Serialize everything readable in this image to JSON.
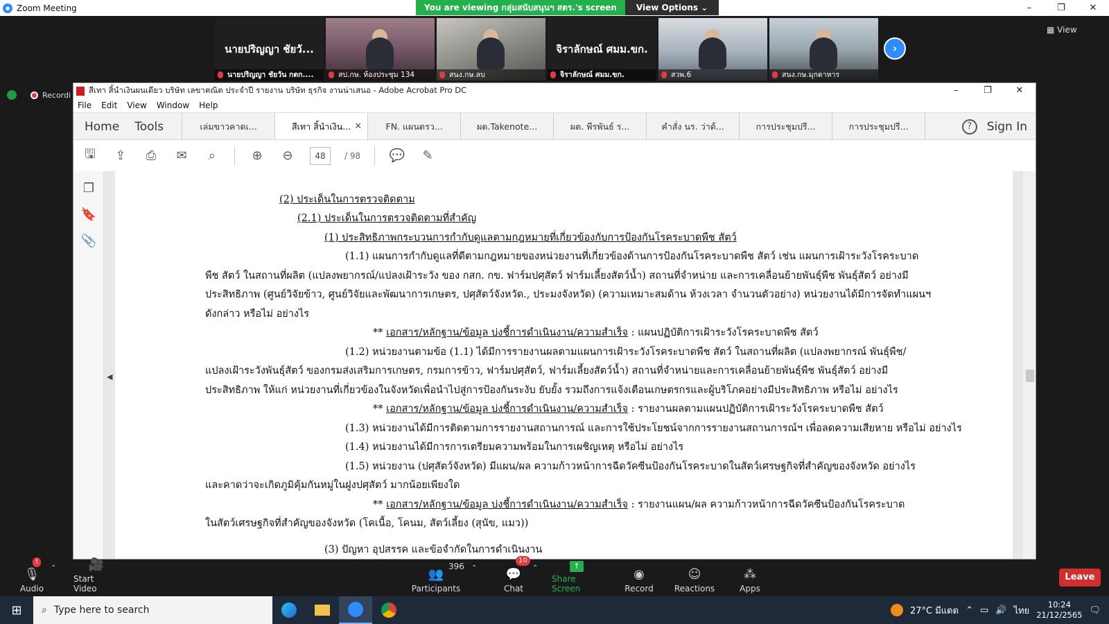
{
  "zoom": {
    "window_title": "Zoom Meeting",
    "share_banner": "You are viewing กลุ่มสนับสนุนฯ สตร.'s screen",
    "view_options": "View Options ⌄",
    "view_button": "View",
    "recording_label": "Recordi",
    "tiles": [
      {
        "kind": "name",
        "name": "นายปริญญา ชัยวั...",
        "caption": "นายปริญญา ชัยวัน กตก...."
      },
      {
        "kind": "video",
        "caption": "สป.กษ. ห้องประชุม 134"
      },
      {
        "kind": "video",
        "caption": "สนง.กษ.ลบ"
      },
      {
        "kind": "name",
        "name": "จิราลักษณ์ ศมม.ขก.",
        "caption": "จิราลักษณ์ ศมม.ขก."
      },
      {
        "kind": "video",
        "caption": "สวพ.6"
      },
      {
        "kind": "video",
        "caption": "สนง.กษ.มุกดาหาร"
      }
    ],
    "bottom": {
      "audio": "Audio",
      "start_video": "Start Video",
      "participants": "Participants",
      "participants_count": "396",
      "chat": "Chat",
      "chat_badge": "10",
      "share_screen": "Share Screen",
      "record": "Record",
      "reactions": "Reactions",
      "apps": "Apps",
      "leave": "Leave"
    }
  },
  "acrobat": {
    "title": "สีเทา สิ้นำเงินผนเดียว บริษัท เลขาคณิต ประจำปี รายงาน บริษัท ธุรกิจ งานน่าเสนอ - Adobe Acrobat Pro DC",
    "menu": [
      "File",
      "Edit",
      "View",
      "Window",
      "Help"
    ],
    "home": "Home",
    "tools": "Tools",
    "tabs": [
      "เล่มขาวคาดเ...",
      "สีเทา สิ้นำเงิน...",
      "FN. แผนตรว...",
      "ผต.Takenote...",
      "ผต. พีรพันธ์ ร...",
      "คำสั่ง นร. ว่าด้...",
      "การประชุมปรี...",
      "การประชุมปรี..."
    ],
    "active_tab_index": 1,
    "sign_in": "Sign In",
    "page_current": "48",
    "page_total": "/ 98"
  },
  "document": {
    "h2": "(2) ประเด็นในการตรวจติดตาม",
    "h21": "(2.1) ประเด็นในการตรวจติดตามที่สำคัญ",
    "h1": "(1)  ประสิทธิภาพกระบวนการกำกับดูแลตามกฎหมายที่เกี่ยวข้องกับการป้องกันโรคระบาดพืช สัตว์",
    "p11_a": "(1.1)   แผนการกำกับดูแลที่ดีตามกฎหมายของหน่วยงานที่เกี่ยวข้องด้านการป้องกันโรคระบาดพืช สัตว์ เช่น แผนการเฝ้าระวังโรคระบาด",
    "p11_b": "พืช สัตว์ ในสถานที่ผลิต (แปลงพยากรณ์/แปลงเฝ้าระวัง ของ กสก. กข. ฟาร์มปศุสัตว์ ฟาร์มเลี้ยงสัตว์น้ำ) สถานที่จำหน่าย และการเคลื่อนย้ายพันธุ์พืช พันธุ์สัตว์ อย่างมี",
    "p11_c": "ประสิทธิภาพ (ศูนย์วิจัยข้าว, ศูนย์วิจัยและพัฒนาการเกษตร, ปศุสัตว์จังหวัด., ประมงจังหวัด) (ความเหมาะสมด้าน ห้วงเวลา จำนวนตัวอย่าง) หน่วยงานได้มีการจัดทำแผนฯ",
    "p11_d": "ดังกล่าว หรือไม่ อย่างไร",
    "ev_prefix": "**",
    "ev_label": "เอกสาร/หลักฐาน/ข้อมูล บ่งชี้การดำเนินงาน/ความสำเร็จ",
    "ev1_rest": " : แผนปฏิบัติการเฝ้าระวังโรคระบาดพืช สัตว์",
    "p12_a": "(1.2)   หน่วยงานตามข้อ (1.1) ได้มีการรายงานผลตามแผนการเฝ้าระวังโรคระบาดพืช สัตว์ ในสถานที่ผลิต (แปลงพยากรณ์ พันธุ์พืช/",
    "p12_b": "แปลงเฝ้าระวังพันธุ์สัตว์ ของกรมส่งเสริมการเกษตร, กรมการข้าว, ฟาร์มปศุสัตว์, ฟาร์มเลี้ยงสัตว์น้ำ) สถานที่จำหน่ายและการเคลื่อนย้ายพันธุ์พืช พันธุ์สัตว์ อย่างมี",
    "p12_c": "ประสิทธิภาพ ให้แก่ หน่วยงานที่เกี่ยวข้องในจังหวัดเพื่อนำไปสู่การป้องกันระงับ ยับยั้ง รวมถึงการแจ้งเตือนเกษตรกรและผู้บริโภคอย่างมีประสิทธิภาพ หรือไม่ อย่างไร",
    "ev2_rest": " : รายงานผลตามแผนปฏิบัติการเฝ้าระวังโรคระบาดพืช สัตว์",
    "p13": "(1.3)   หน่วยงานได้มีการติดตามการรายงานสถานการณ์ และการใช้ประโยชน์จากการรายงานสถานการณ์ฯ เพื่อลดความเสียหาย หรือไม่ อย่างไร",
    "p14": "(1.4)   หน่วยงานได้มีการการเตรียมความพร้อมในการเผชิญเหตุ หรือไม่ อย่างไร",
    "p15_a": "(1.5)   หน่วยงาน (ปศุสัตว์จังหวัด) มีแผน/ผล ความก้าวหน้าการฉีดวัคซีนป้องกันโรคระบาดในสัตว์เศรษฐกิจที่สำคัญของจังหวัด อย่างไร",
    "p15_b": "และคาดว่าจะเกิดภูมิคุ้มกันหมู่ในฝูงปศุสัตว์ มากน้อยเพียงใด",
    "ev3_rest": " : รายงานแผน/ผล ความก้าวหน้าการฉีดวัคซีนป้องกันโรคระบาด",
    "ev3_b": "ในสัตว์เศรษฐกิจที่สำคัญของจังหวัด (โคเนื้อ, โคนม, สัตว์เลี้ยง (สุนัข, แมว))",
    "h3_cut": "(3)  ปัญหา อุปสรรค และข้อจำกัดในการดำเนินงาน"
  },
  "taskbar": {
    "search_placeholder": "Type here to search",
    "weather": "27°C มีแดด",
    "lang": "ไทย",
    "time": "10:24",
    "date": "21/12/2565"
  }
}
